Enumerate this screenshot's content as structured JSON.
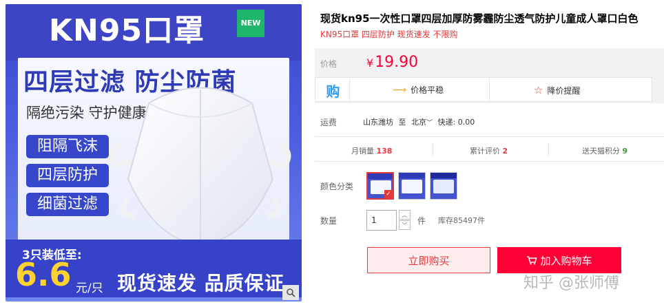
{
  "product_image": {
    "banner_title": "KN95口罩",
    "new_badge": "NEW",
    "headline": "四层过滤 防尘防菌",
    "subheadline": "隔绝污染 守护健康",
    "tags": [
      "阻隔飞沫",
      "四层防护",
      "细菌过滤"
    ],
    "promo_label": "3只装低至:",
    "promo_price": "6.6",
    "promo_unit": "元/只",
    "slogan": "现货速发 品质保证"
  },
  "product": {
    "title": "现货kn95一次性口罩四层加厚防雾霾防尘透气防护儿童成人罩口白色",
    "subtitle": "KN95口罩 四层防护 现货速发 不限购"
  },
  "price": {
    "label": "价格",
    "currency": "¥",
    "value": "19.90"
  },
  "buy_bar": {
    "icon_text": "购",
    "price_trend": "价格平稳",
    "price_alert": "降价提醒"
  },
  "shipping": {
    "label": "运费",
    "from": "山东潍坊",
    "to_word": "至",
    "destination": "北京",
    "express": "快递: 0.00"
  },
  "stats": {
    "monthly_sales_label": "月销量",
    "monthly_sales_value": "138",
    "reviews_label": "累计评价",
    "reviews_value": "2",
    "points_label": "送天猫积分",
    "points_value": "9"
  },
  "color": {
    "label": "颜色分类"
  },
  "quantity": {
    "label": "数量",
    "value": "1",
    "unit": "件",
    "stock": "库存85497件"
  },
  "actions": {
    "buy_now": "立即购买",
    "add_to_cart": "加入购物车"
  },
  "watermark": "知乎 @张师傅",
  "colors": {
    "accent_red": "#ff0036",
    "brand_blue": "#3d44c6",
    "price_yellow": "#ffd230"
  }
}
